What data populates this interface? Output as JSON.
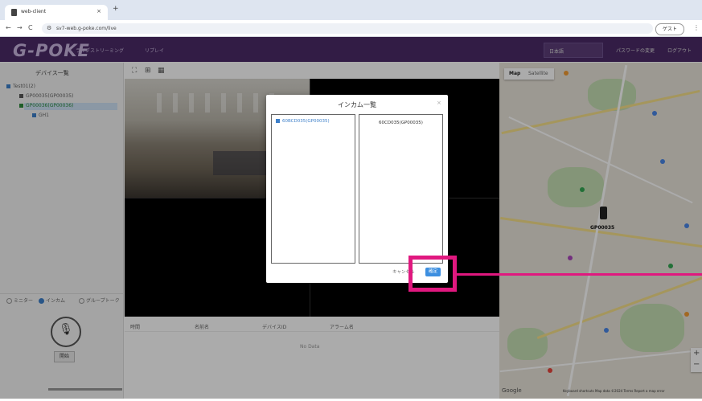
{
  "browser": {
    "tab_title": "web-client",
    "tab_close": "×",
    "new_tab": "+",
    "back": "←",
    "forward": "→",
    "reload": "C",
    "url": "sv7-web.g-poke.com/live",
    "guest_label": "ゲスト",
    "menu": "⋮"
  },
  "header": {
    "logo": "G-POKE",
    "nav": [
      "ライブストリーミング",
      "リプレイ"
    ],
    "language": "日本語",
    "change_password": "パスワードの変更",
    "logout": "ログアウト"
  },
  "sidebar": {
    "title": "デバイス一覧",
    "tree": [
      {
        "label": "Test01(2)",
        "level": 0
      },
      {
        "label": "GP00035(GP00035)",
        "level": 1
      },
      {
        "label": "GP00036(GP00036)",
        "level": 1,
        "selected": true
      },
      {
        "label": "GH1",
        "level": 2
      }
    ],
    "mode_options": [
      "ミニター",
      "インカム",
      "グループトーク"
    ],
    "mode_selected": "インカム",
    "mic_button_label": "開始"
  },
  "layout_icons": [
    "layout-1x1-icon",
    "layout-2x2-icon",
    "layout-3x3-icon"
  ],
  "event_table": {
    "columns": [
      "時間",
      "名前名",
      "デバイスID",
      "アラーム名"
    ],
    "empty_text": "No Data"
  },
  "map": {
    "type_map": "Map",
    "type_satellite": "Satellite",
    "marker_label": "GP00035",
    "google": "Google",
    "footer": "Keyboard shortcuts   Map data ©2024   Terms   Report a map error",
    "zoom_in": "+",
    "zoom_out": "−"
  },
  "dialog": {
    "title": "インカム一覧",
    "close": "×",
    "left_items": [
      "60BCD035(GP00035)"
    ],
    "right_items": [
      "60CD035(GP00035)"
    ],
    "cancel": "キャンセル",
    "ok": "確定"
  },
  "colors": {
    "header_purple": "#4b2a67",
    "accent_blue": "#3d8fe0",
    "highlight_magenta": "#e0187f"
  }
}
